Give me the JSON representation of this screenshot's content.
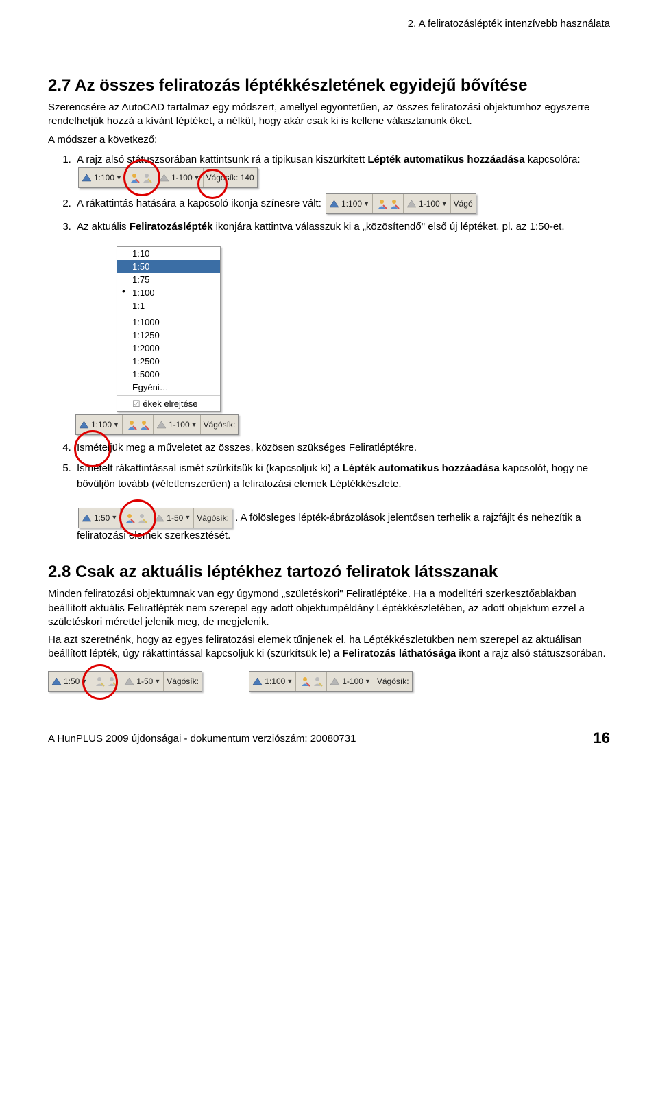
{
  "header": "2. A feliratozáslépték intenzívebb használata",
  "s27": {
    "title": "2.7 Az összes feliratozás léptékkészletének egyidejű bővítése",
    "p1": "Szerencsére az AutoCAD tartalmaz egy módszert, amellyel egyöntetűen, az összes feliratozási objektumhoz egyszerre rendelhetjük hozzá a kívánt léptéket, a nélkül, hogy akár csak ki is kellene választanunk őket.",
    "p2": "A módszer a következő:",
    "li1a": "A rajz alsó státuszsorában kattintsunk rá a tipikusan kiszürkített ",
    "li1b": "Lépték automatikus hozzáadása",
    "li1c": " kapcsolóra: ",
    "li2": "A rákattintás hatására a kapcsoló ikonja színesre vált: ",
    "li3a": "Az aktuális ",
    "li3b": "Feliratozáslépték",
    "li3c": " ikonjára kattintva válasszuk ki a „közösítendő\" első új léptéket. pl. az 1:50-et.",
    "li4": "Ismételjük meg a műveletet az összes, közösen szükséges Feliratléptékre.",
    "li5a": "Ismételt rákattintással ismét szürkítsük ki (kapcsoljuk ki) a ",
    "li5b": "Lépték automatikus hozzáadása",
    "li5c": " kapcsolót, hogy ne bővüljön tovább (véletlenszerűen) a feliratozási elemek Léptékkészlete.",
    "li5d": ". A fölösleges lépték-ábrázolások jelentősen terhelik a rajzfájlt és nehezítik a feliratozási elemek szerkesztését."
  },
  "status1": {
    "scale": "1:100",
    "scale2": "1-100",
    "cut": "Vágósík: 140"
  },
  "status2": {
    "scale": "1:100",
    "scale2": "1-100",
    "cut": "Vágó"
  },
  "dropdown": [
    "1:10",
    "1:50",
    "1:75",
    "1:100",
    "1:1",
    "1:1000",
    "1:1250",
    "1:2000",
    "1:2500",
    "1:5000",
    "Egyéni…"
  ],
  "dd_hide": "ékek elrejtése",
  "status3": {
    "scale": "1:100",
    "scale2": "1-100",
    "cut": "Vágósík:"
  },
  "status4": {
    "scale": "1:50",
    "scale2": "1-50",
    "cut": "Vágósík:"
  },
  "s28": {
    "title": "2.8 Csak az aktuális léptékhez tartozó feliratok látsszanak",
    "p1": "Minden feliratozási objektumnak van egy úgymond „születéskori\" Feliratléptéke. Ha a modelltéri szerkesztőablakban beállított aktuális Feliratlépték nem szerepel egy adott objektumpéldány Léptékkészletében, az adott objektum ezzel a születéskori mérettel jelenik meg, de megjelenik.",
    "p2a": "Ha azt szeretnénk, hogy az egyes feliratozási elemek tűnjenek el, ha Léptékkészletükben nem szerepel az aktuálisan beállított lépték, úgy rákattintással kapcsoljuk ki (szürkítsük le) a ",
    "p2b": "Feliratozás láthatósága",
    "p2c": " ikont a rajz alsó státuszsorában."
  },
  "status5a": {
    "scale": "1:50",
    "scale2": "1-50",
    "cut": "Vágósík:"
  },
  "status5b": {
    "scale": "1:100",
    "scale2": "1-100",
    "cut": "Vágósík:"
  },
  "footer": "A HunPLUS 2009 újdonságai - dokumentum verziószám: 20080731",
  "page": "16"
}
